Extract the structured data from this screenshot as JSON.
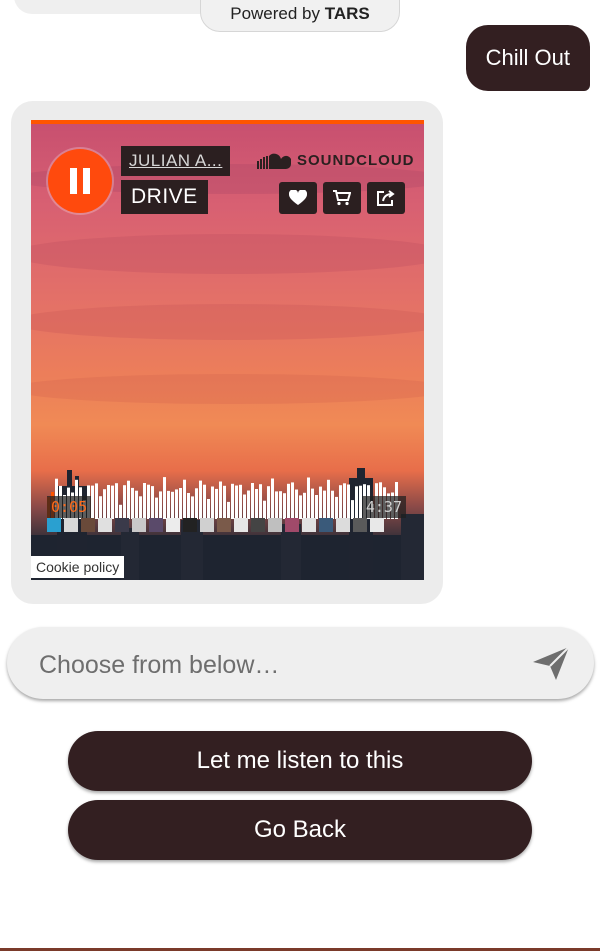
{
  "footer_brand": {
    "prefix": "Powered by ",
    "brand": "TARS"
  },
  "user_message": {
    "text": "Chill Out"
  },
  "player": {
    "provider": "SOUNDCLOUD",
    "artist": "JULIAN A...",
    "title": "DRIVE",
    "elapsed": "0:05",
    "duration": "4:37",
    "progress": 0.018,
    "state": "playing",
    "accent_color": "#ff5500",
    "actions": [
      "heart-icon",
      "cart-icon",
      "share-icon"
    ],
    "cookie_label": "Cookie policy"
  },
  "composer": {
    "placeholder": "Choose from below…"
  },
  "choices": [
    {
      "label": "Let me listen to this"
    },
    {
      "label": "Go Back"
    }
  ],
  "colors": {
    "button_bg": "#331f21",
    "bubble_bg": "#ececec"
  }
}
